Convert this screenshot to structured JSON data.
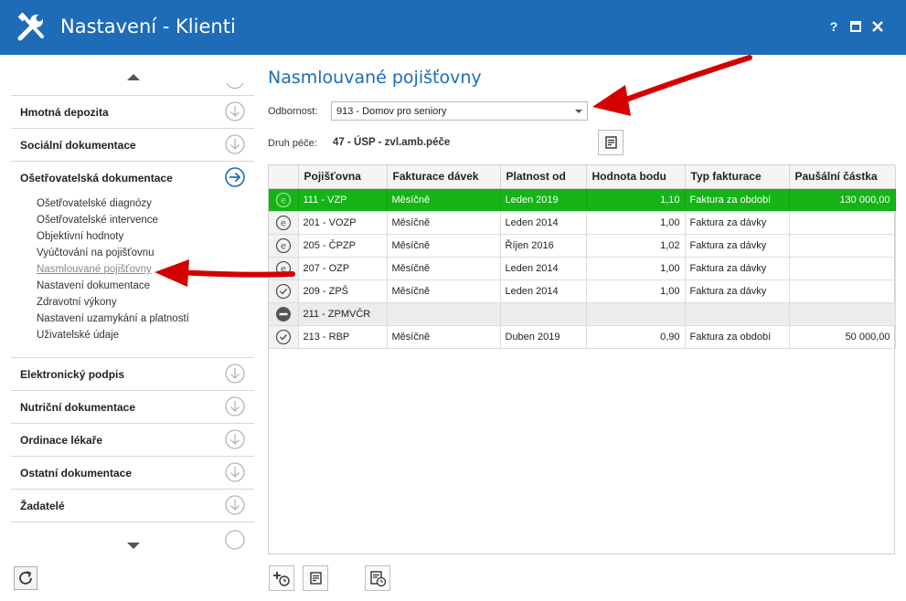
{
  "window": {
    "title": "Nastavení - Klienti",
    "help_label": "?",
    "icon": "wrench-screwdriver-icon"
  },
  "sidebar": {
    "groups_top": [
      {
        "label": "Hmotná depozita",
        "icon": "chevron-down-circle-icon"
      },
      {
        "label": "Sociální dokumentace",
        "icon": "chevron-down-circle-icon"
      },
      {
        "label": "Ošetřovatelská dokumentace",
        "icon": "arrow-right-circle-icon"
      }
    ],
    "sub_items": [
      {
        "label": "Ošetřovatelské diagnózy"
      },
      {
        "label": "Ošetřovatelské intervence"
      },
      {
        "label": "Objektivní hodnoty"
      },
      {
        "label": "Vyúčtování na pojišťovnu"
      },
      {
        "label": "Nasmlouvané pojišťovny"
      },
      {
        "label": "Nastavení dokumentace"
      },
      {
        "label": "Zdravotní výkony"
      },
      {
        "label": "Nastavení uzamykání a platností"
      },
      {
        "label": "Uživatelské údaje"
      }
    ],
    "groups_bottom": [
      {
        "label": "Elektronický podpis"
      },
      {
        "label": "Nutriční dokumentace"
      },
      {
        "label": "Ordinace lékaře"
      },
      {
        "label": "Ostatní dokumentace"
      },
      {
        "label": "Žadatelé"
      }
    ],
    "accent_color": "#1e6bb8"
  },
  "main": {
    "title": "Nasmlouvané pojišťovny",
    "odbornost_label": "Odbornost:",
    "odbornost_value": "913 - Domov pro seniory",
    "druh_label": "Druh péče:",
    "druh_value": "47 - ÚSP - zvl.amb.péče"
  },
  "table": {
    "headers": [
      "Pojišťovna",
      "Fakturace dávek",
      "Platnost od",
      "Hodnota bodu",
      "Typ fakturace",
      "Paušální částka"
    ],
    "rows": [
      {
        "status": "e-circle-icon",
        "pojistovna": "111 - VZP",
        "fakturace": "Měsíčně",
        "platnost": "Leden 2019",
        "hodnota": "1,10",
        "typ": "Faktura za období",
        "pausal": "130 000,00",
        "highlight": true
      },
      {
        "status": "e-circle-icon",
        "pojistovna": "201 - VOZP",
        "fakturace": "Měsíčně",
        "platnost": "Leden 2014",
        "hodnota": "1,00",
        "typ": "Faktura za dávky",
        "pausal": ""
      },
      {
        "status": "e-circle-icon",
        "pojistovna": "205 - ČPZP",
        "fakturace": "Měsíčně",
        "platnost": "Říjen 2016",
        "hodnota": "1,02",
        "typ": "Faktura za dávky",
        "pausal": ""
      },
      {
        "status": "e-circle-icon",
        "pojistovna": "207 - OZP",
        "fakturace": "Měsíčně",
        "platnost": "Leden 2014",
        "hodnota": "1,00",
        "typ": "Faktura za dávky",
        "pausal": ""
      },
      {
        "status": "check-circle-icon",
        "pojistovna": "209 - ZPŠ",
        "fakturace": "Měsíčně",
        "platnost": "Leden 2014",
        "hodnota": "1,00",
        "typ": "Faktura za dávky",
        "pausal": ""
      },
      {
        "status": "minus-circle-icon",
        "pojistovna": "211 - ZPMVČR",
        "fakturace": "",
        "platnost": "",
        "hodnota": "",
        "typ": "",
        "pausal": "",
        "gray": true
      },
      {
        "status": "check-circle-icon",
        "pojistovna": "213 - RBP",
        "fakturace": "Měsíčně",
        "platnost": "Duben 2019",
        "hodnota": "0,90",
        "typ": "Faktura za období",
        "pausal": "50 000,00"
      }
    ],
    "highlight_color": "#16b316"
  },
  "annotation_color": "#d40000"
}
